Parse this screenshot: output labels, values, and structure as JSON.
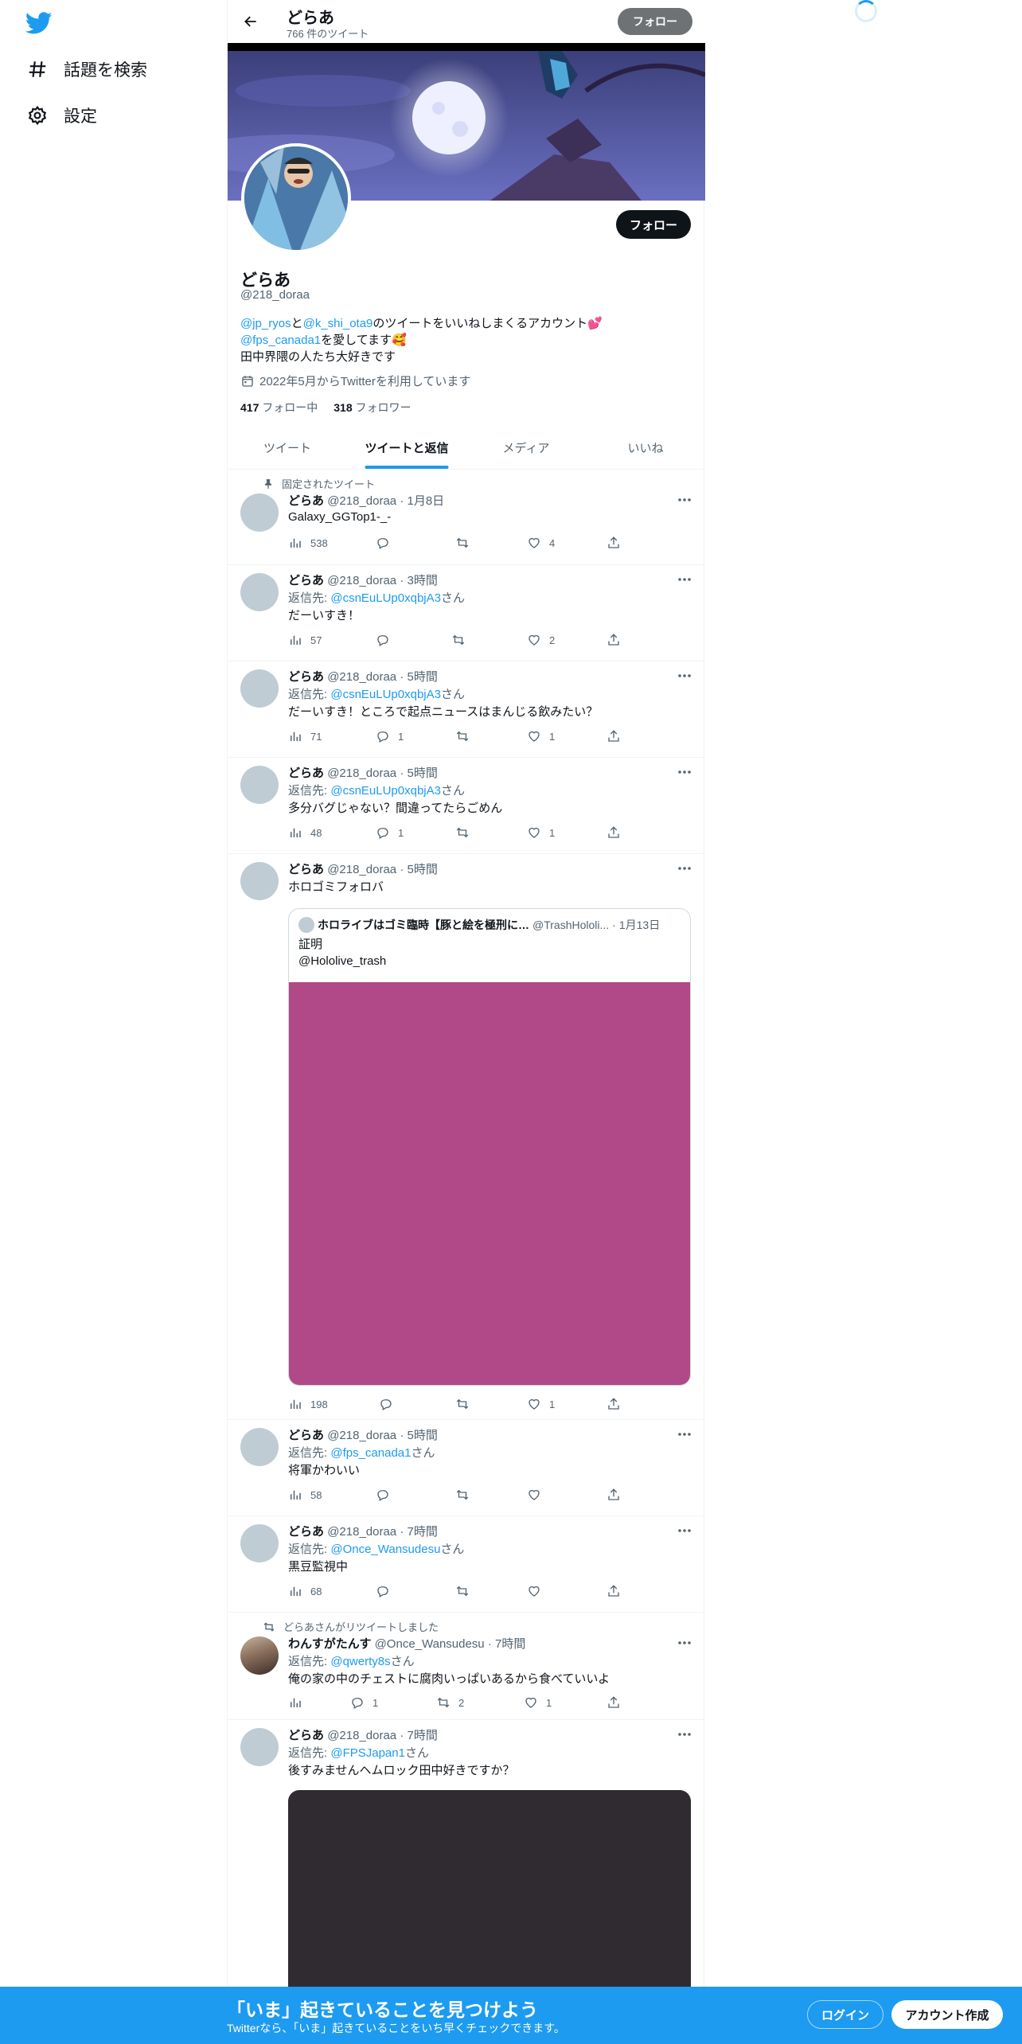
{
  "nav": {
    "explore_label": "話題を検索",
    "settings_label": "設定"
  },
  "header": {
    "name": "どらあ",
    "tweet_count": "766 件のツイート",
    "follow_label": "フォロー"
  },
  "profile": {
    "follow_label": "フォロー",
    "name": "どらあ",
    "handle": "@218_doraa",
    "bio": {
      "mention1": "@jp_ryos",
      "and": "と",
      "mention2": "@k_shi_ota9",
      "line1_rest": "のツイートをいいねしまくるアカウント💕",
      "mention3": "@fps_canada1",
      "line2_rest": "を愛してます🥰",
      "line3": "田中界隈の人たち大好きです"
    },
    "joined": "2022年5月からTwitterを利用しています",
    "following_count": "417",
    "following_label": "フォロー中",
    "followers_count": "318",
    "followers_label": "フォロワー"
  },
  "tabs": [
    {
      "label": "ツイート",
      "active": false
    },
    {
      "label": "ツイートと返信",
      "active": true
    },
    {
      "label": "メディア",
      "active": false
    },
    {
      "label": "いいね",
      "active": false
    }
  ],
  "tweets": [
    {
      "pinned_label": "固定されたツイート",
      "name": "どらあ",
      "handle": "@218_doraa",
      "time": "1月8日",
      "text": "Galaxy_GGTop1-_-",
      "views": "538",
      "replies": "",
      "retweets": "",
      "likes": "4"
    },
    {
      "name": "どらあ",
      "handle": "@218_doraa",
      "time": "3時間",
      "reply_prefix": "返信先: ",
      "reply_to": "@csnEuLUp0xqbjA3",
      "reply_suffix": "さん",
      "text": "だーいすき！",
      "views": "57",
      "replies": "",
      "retweets": "",
      "likes": "2"
    },
    {
      "name": "どらあ",
      "handle": "@218_doraa",
      "time": "5時間",
      "reply_prefix": "返信先: ",
      "reply_to": "@csnEuLUp0xqbjA3",
      "reply_suffix": "さん",
      "text": "だーいすき！ところで起点ニュースはまんじる飲みたい？",
      "views": "71",
      "replies": "1",
      "retweets": "",
      "likes": "1"
    },
    {
      "name": "どらあ",
      "handle": "@218_doraa",
      "time": "5時間",
      "reply_prefix": "返信先: ",
      "reply_to": "@csnEuLUp0xqbjA3",
      "reply_suffix": "さん",
      "text": "多分バグじゃない？間違ってたらごめん",
      "views": "48",
      "replies": "1",
      "retweets": "",
      "likes": "1"
    },
    {
      "name": "どらあ",
      "handle": "@218_doraa",
      "time": "5時間",
      "text": "ホロゴミフォロバ",
      "views": "198",
      "replies": "",
      "retweets": "",
      "likes": "1",
      "quote": {
        "name": "ホロライブはゴミ臨時【豚と絵を極刑に…",
        "handle": "@TrashHololi...",
        "time": "1月13日",
        "line1": "証明",
        "line2": "@Hololive_trash"
      }
    },
    {
      "name": "どらあ",
      "handle": "@218_doraa",
      "time": "5時間",
      "reply_prefix": "返信先: ",
      "reply_to": "@fps_canada1",
      "reply_suffix": "さん",
      "text": "将軍かわいい",
      "views": "58",
      "replies": "",
      "retweets": "",
      "likes": ""
    },
    {
      "name": "どらあ",
      "handle": "@218_doraa",
      "time": "7時間",
      "reply_prefix": "返信先: ",
      "reply_to": "@Once_Wansudesu",
      "reply_suffix": "さん",
      "text": "黒豆監視中",
      "views": "68",
      "replies": "",
      "retweets": "",
      "likes": ""
    },
    {
      "retweet_label": "どらあさんがリツイートしました",
      "name": "わんすがたんす",
      "handle": "@Once_Wansudesu",
      "time": "7時間",
      "reply_prefix": "返信先: ",
      "reply_to": "@qwerty8s",
      "reply_suffix": "さん",
      "text": "俺の家の中のチェストに腐肉いっぱいあるから食べていいよ",
      "views": "",
      "replies": "1",
      "retweets": "2",
      "likes": "1"
    },
    {
      "name": "どらあ",
      "handle": "@218_doraa",
      "time": "7時間",
      "reply_prefix": "返信先: ",
      "reply_to": "@FPSJapan1",
      "reply_suffix": "さん",
      "text": "後すみませんヘムロック田中好きですか？"
    }
  ],
  "bottom_bar": {
    "title": "「いま」起きていることを見つけよう",
    "subtitle": "Twitterなら、「いま」起きていることをいち早くチェックできます。",
    "login_label": "ログイン",
    "signup_label": "アカウント作成"
  },
  "colors": {
    "accent": "#1d9bf0",
    "text_primary": "#0f1419",
    "text_secondary": "#536471",
    "quote_media": "#b14887",
    "dark_media": "#2f2b30"
  }
}
